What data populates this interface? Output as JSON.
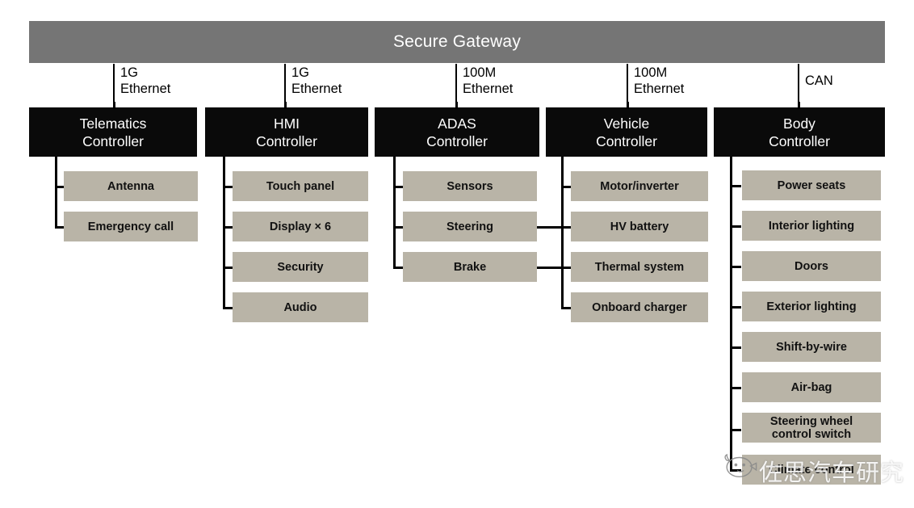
{
  "diagram": {
    "title": "Secure Gateway"
  },
  "networks": [
    {
      "id": "net-1g-eth-telematics",
      "label": "1G\nEthernet"
    },
    {
      "id": "net-1g-eth-hmi",
      "label": "1G\nEthernet"
    },
    {
      "id": "net-100m-eth-adas",
      "label": "100M\nEthernet"
    },
    {
      "id": "net-100m-eth-vehicle",
      "label": "100M\nEthernet"
    },
    {
      "id": "net-can-body",
      "label": "CAN"
    }
  ],
  "controllers": [
    {
      "id": "telematics",
      "line1": "Telematics",
      "line2": "Controller"
    },
    {
      "id": "hmi",
      "line1": "HMI",
      "line2": "Controller"
    },
    {
      "id": "adas",
      "line1": "ADAS",
      "line2": "Controller"
    },
    {
      "id": "vehicle",
      "line1": "Vehicle",
      "line2": "Controller"
    },
    {
      "id": "body",
      "line1": "Body",
      "line2": "Controller"
    }
  ],
  "leaves": {
    "telematics": [
      {
        "label": "Antenna"
      },
      {
        "label": "Emergency call"
      }
    ],
    "hmi": [
      {
        "label": "Touch panel"
      },
      {
        "label": "Display × 6"
      },
      {
        "label": "Security"
      },
      {
        "label": "Audio"
      }
    ],
    "adas": [
      {
        "label": "Sensors"
      },
      {
        "label": "Steering"
      },
      {
        "label": "Brake"
      }
    ],
    "vehicle": [
      {
        "label": "Motor/inverter"
      },
      {
        "label": "HV battery"
      },
      {
        "label": "Thermal system"
      },
      {
        "label": "Onboard charger"
      }
    ],
    "body": [
      {
        "label": "Power seats"
      },
      {
        "label": "Interior lighting"
      },
      {
        "label": "Doors"
      },
      {
        "label": "Exterior lighting"
      },
      {
        "label": "Shift-by-wire"
      },
      {
        "label": "Air-bag"
      },
      {
        "label": "Steering wheel",
        "label2": "control switch"
      },
      {
        "label": "Climate control"
      }
    ]
  },
  "watermark": {
    "text": "佐思汽车研究"
  },
  "colors": {
    "gateway_bg": "#757575",
    "controller_bg": "#0a0a0a",
    "leaf_bg": "#b9b4a7",
    "line": "#000000",
    "page_bg": "#ffffff"
  }
}
